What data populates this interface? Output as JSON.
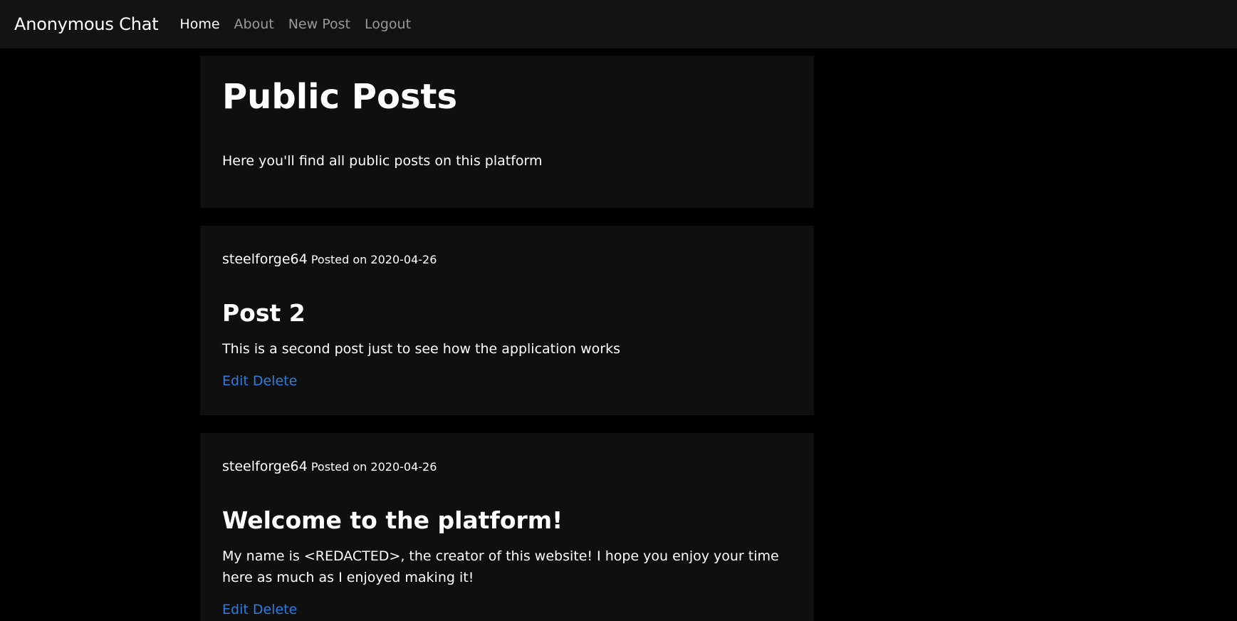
{
  "nav": {
    "brand": "Anonymous Chat",
    "links": [
      {
        "label": "Home",
        "active": true
      },
      {
        "label": "About",
        "active": false
      },
      {
        "label": "New Post",
        "active": false
      },
      {
        "label": "Logout",
        "active": false
      }
    ]
  },
  "header": {
    "title": "Public Posts",
    "lead": "Here you'll find all public posts on this platform"
  },
  "posts": [
    {
      "author": "steelforge64",
      "posted": "Posted on 2020-04-26",
      "title": "Post 2",
      "body": "This is a second post just to see how the application works",
      "edit_label": "Edit",
      "delete_label": "Delete"
    },
    {
      "author": "steelforge64",
      "posted": "Posted on 2020-04-26",
      "title": "Welcome to the platform!",
      "body": "My name is <REDACTED>, the creator of this website! I hope you enjoy your time here as much as I enjoyed making it!",
      "edit_label": "Edit",
      "delete_label": "Delete"
    }
  ],
  "colors": {
    "background": "#000000",
    "navbar": "#131313",
    "card": "#0f0f0f",
    "link": "#2d7de0",
    "nav_inactive": "#9a9a9a"
  }
}
